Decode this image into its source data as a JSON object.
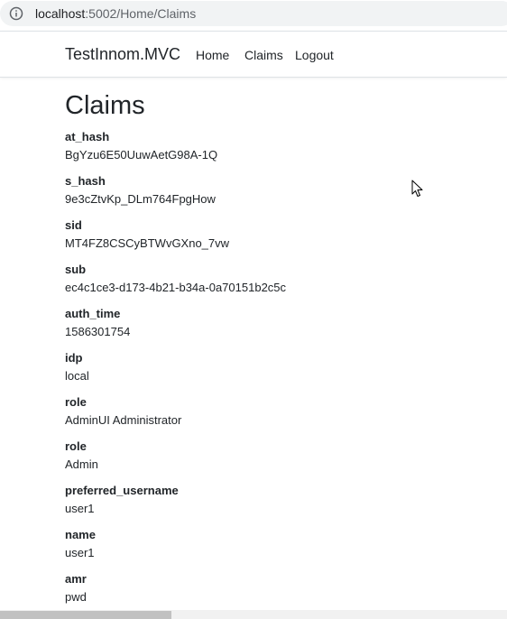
{
  "browser": {
    "url_host": "localhost",
    "url_path": ":5002/Home/Claims"
  },
  "navbar": {
    "brand": "TestInnom.MVC",
    "links": [
      "Home",
      "Claims",
      "Logout"
    ]
  },
  "page": {
    "title": "Claims"
  },
  "claims": [
    {
      "type": "at_hash",
      "value": "BgYzu6E50UuwAetG98A-1Q"
    },
    {
      "type": "s_hash",
      "value": "9e3cZtvKp_DLm764FpgHow"
    },
    {
      "type": "sid",
      "value": "MT4FZ8CSCyBTWvGXno_7vw"
    },
    {
      "type": "sub",
      "value": "ec4c1ce3-d173-4b21-b34a-0a70151b2c5c"
    },
    {
      "type": "auth_time",
      "value": "1586301754"
    },
    {
      "type": "idp",
      "value": "local"
    },
    {
      "type": "role",
      "value": "AdminUI Administrator"
    },
    {
      "type": "role",
      "value": "Admin"
    },
    {
      "type": "preferred_username",
      "value": "user1"
    },
    {
      "type": "name",
      "value": "user1"
    },
    {
      "type": "amr",
      "value": "pwd"
    }
  ],
  "icons": {
    "address_info": "info-circle-icon",
    "cursor": "mouse-pointer-icon"
  },
  "colors": {
    "text": "#212529",
    "omnibox_bg": "#f1f3f4",
    "url_path": "#5f6368"
  }
}
